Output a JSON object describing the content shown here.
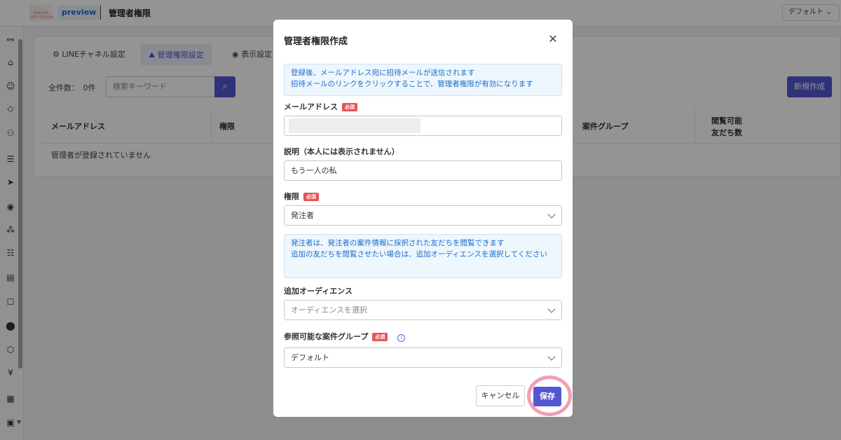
{
  "header": {
    "logo_text": "SAKURA LIFE DESIGN",
    "preview_badge": "preview",
    "page_title": "管理者権限",
    "scope_select": "デフォルト ⌄"
  },
  "sidebar": {
    "icons": [
      "users-icon",
      "tag-icon",
      "smile-icon",
      "ticket-icon",
      "person-icon",
      "list-icon",
      "send-icon",
      "chat-line-icon",
      "tree-icon",
      "document-icon",
      "file-icon",
      "comment-icon",
      "location-icon",
      "box-icon",
      "yen-icon",
      "building-icon",
      "calendar-icon"
    ],
    "glyphs": [
      "⚯",
      "⌂",
      "☺",
      "◇",
      "⚇",
      "☰",
      "➤",
      "◉",
      "⁂",
      "☷",
      "▤",
      "☐",
      "⬤",
      "⬡",
      "¥",
      "▦",
      "▣"
    ]
  },
  "main": {
    "tabs": [
      {
        "label": "⚙ LINEチャネル設定"
      },
      {
        "label": "⛰ 管理権限設定"
      },
      {
        "label": "◉ 表示設定"
      }
    ],
    "count_label": "全件数：　0件",
    "search_placeholder": "検索キーワード",
    "search_glyph": "⌕",
    "new_button": "新規作成",
    "columns": [
      "メールアドレス",
      "権限",
      "案件グループ",
      "閲覧可能",
      "友だち数"
    ],
    "empty_message": "管理者が登録されていません"
  },
  "modal": {
    "title": "管理者権限作成",
    "close_glyph": "✕",
    "info_top": [
      "登録後、メールアドレス宛に招待メールが送信されます",
      "招待メールのリンクをクリックすることで、管理者権限が有効になります"
    ],
    "email_label": "メールアドレス",
    "required_badge": "必須",
    "email_value": "",
    "description_label": "説明（本人には表示されません）",
    "description_value": "もう一人の私",
    "role_label": "権限",
    "role_value": "発注者",
    "info_role": [
      "発注者は、発注者の案件情報に採択された友だちを閲覧できます",
      "追加の友だちを閲覧させたい場合は、追加オーディエンスを選択してください"
    ],
    "audience_label": "追加オーディエンス",
    "audience_placeholder": "オーディエンスを選択",
    "group_label": "参照可能な案件グループ",
    "info_glyph": "i",
    "group_value": "デフォルト",
    "cancel_button": "キャンセル",
    "save_button": "保存"
  }
}
